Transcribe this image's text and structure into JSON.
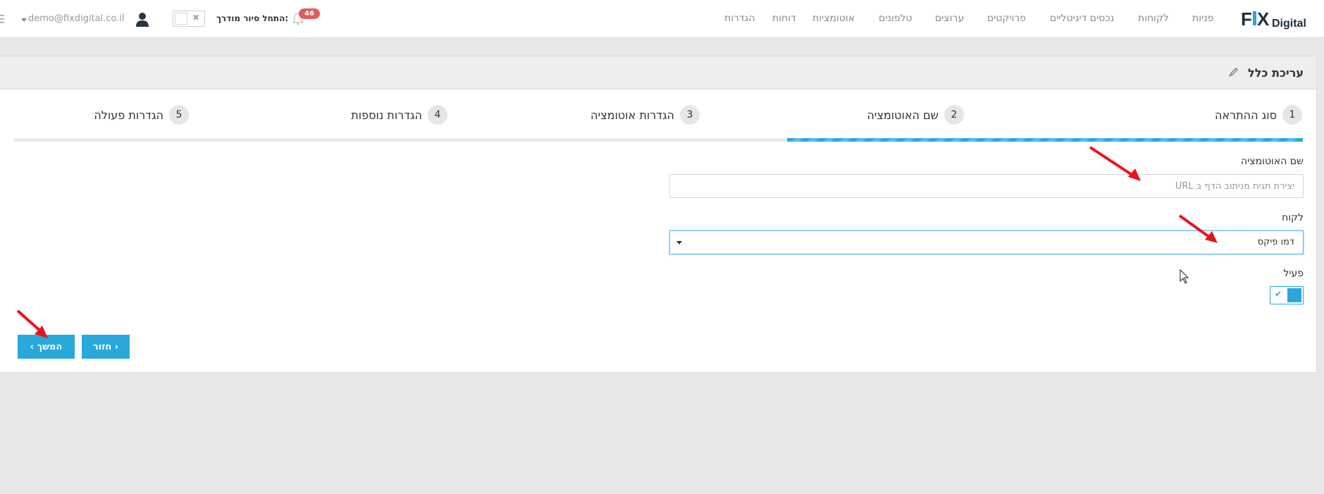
{
  "header": {
    "logo_text": "Digital",
    "nav": [
      {
        "label": "פניות"
      },
      {
        "label": "לקוחות"
      },
      {
        "label": "נכסים דיגיטליים"
      },
      {
        "label": "פרויקטים"
      },
      {
        "label": "ערוצים"
      },
      {
        "label": "טלפונים"
      },
      {
        "label": "אוטומציות"
      },
      {
        "label": "דוחות"
      },
      {
        "label": "הגדרות"
      }
    ],
    "notifications_count": "46",
    "tour_label": "התחל סיור מודרך:",
    "tour_toggle_off_glyph": "✖",
    "user_email": "demo@fixdigital.co.il",
    "icons": [
      "logo",
      "bell-icon",
      "user-icon",
      "menu-icon",
      "chevron-down-icon"
    ]
  },
  "panel": {
    "title": "עריכת כלל",
    "title_icon": "pencil-icon"
  },
  "steps": [
    {
      "num": "1",
      "label": "סוג ההתראה"
    },
    {
      "num": "2",
      "label": "שם האוטומציה"
    },
    {
      "num": "3",
      "label": "הגדרות אוטומציה"
    },
    {
      "num": "4",
      "label": "הגדרות נוספות"
    },
    {
      "num": "5",
      "label": "הגדרות פעולה"
    }
  ],
  "progress": {
    "current_step": 2,
    "total_steps": 5,
    "completed_fraction": 0.4
  },
  "form": {
    "name_label": "שם האוטומציה",
    "name_placeholder": "יצירת תגית מניתוב הדף ב URL",
    "name_value": "",
    "client_label": "לקוח",
    "client_value": "דמו פיקס",
    "active_label": "פעיל",
    "active": true,
    "active_check": "✔"
  },
  "buttons": {
    "back": "‹ חזור",
    "next": "המשך ›"
  },
  "colors": {
    "accent": "#29a8dc",
    "badge": "#e35a5a",
    "annotation_arrow": "#e8141c"
  }
}
